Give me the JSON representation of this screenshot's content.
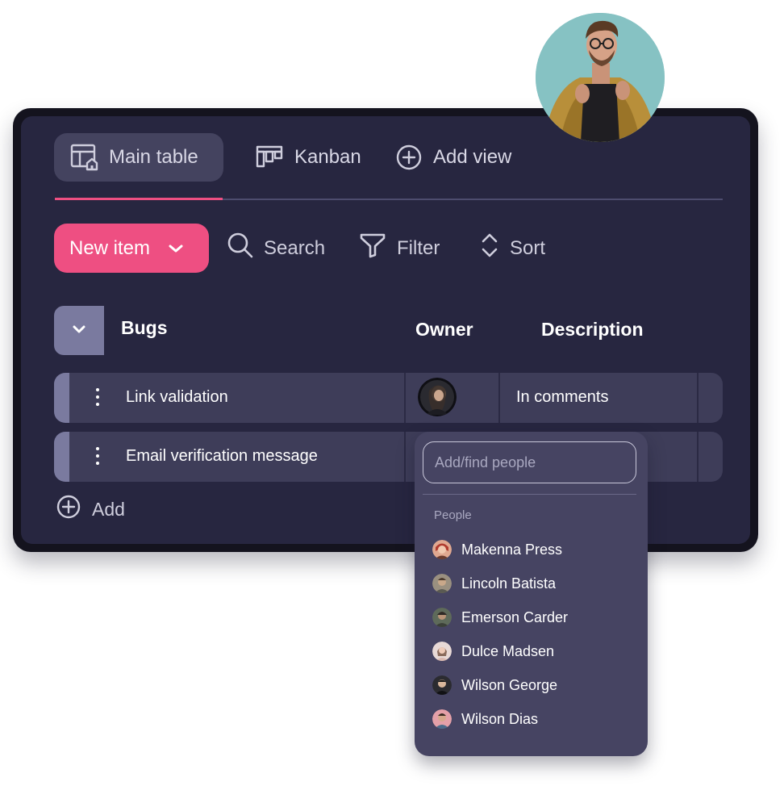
{
  "tabs": [
    {
      "label": "Main table",
      "icon": "table-home-icon",
      "active": true
    },
    {
      "label": "Kanban",
      "icon": "kanban-icon",
      "active": false
    },
    {
      "label": "Add view",
      "icon": "plus-circle-icon",
      "active": false
    }
  ],
  "toolbar": {
    "new_item_label": "New item",
    "search_label": "Search",
    "filter_label": "Filter",
    "sort_label": "Sort"
  },
  "group": {
    "title": "Bugs",
    "columns": {
      "owner": "Owner",
      "description": "Description"
    }
  },
  "rows": [
    {
      "name": "Link validation",
      "description": "In comments",
      "owner_avatar": true
    },
    {
      "name": "Email verification message",
      "description": "",
      "owner_avatar": false
    }
  ],
  "add_label": "Add",
  "people_picker": {
    "placeholder": "Add/find people",
    "section_label": "People",
    "people": [
      {
        "name": "Makenna Press"
      },
      {
        "name": "Lincoln Batista"
      },
      {
        "name": "Emerson Carder"
      },
      {
        "name": "Dulce Madsen"
      },
      {
        "name": "Wilson George"
      },
      {
        "name": "Wilson Dias"
      }
    ]
  },
  "colors": {
    "accent": "#ee4f82",
    "board_bg": "#272640",
    "row_bg": "#3e3d59",
    "dropdown_bg": "#464462"
  }
}
